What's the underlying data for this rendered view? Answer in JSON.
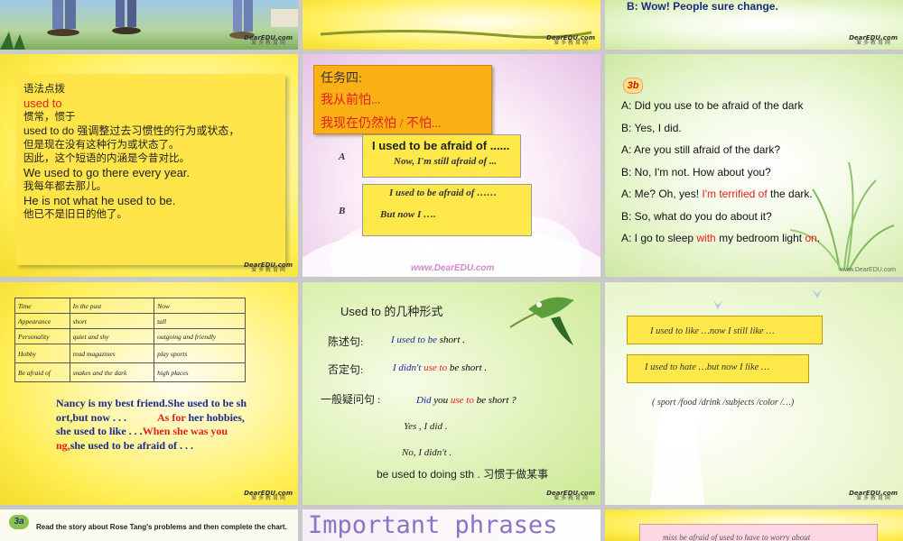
{
  "logo": {
    "brand": "DearEDU.com",
    "sub": "爱 多 教 育 网"
  },
  "s3": {
    "line": "B: Wow! People sure change."
  },
  "s4": {
    "lines": [
      "语法点拨",
      "used to",
      "惯常，惯于",
      "used to do  强调整过去习惯性的行为或状态，",
      "但是现在没有这种行为或状态了。",
      "因此，这个短语的内涵是今昔对比。",
      "We used to go there every year.",
      "我每年都去那儿。",
      "He is not what he used to be.",
      "他已不是旧日的他了。"
    ]
  },
  "s5": {
    "task_title": "任务四:",
    "task_l1": "我从前怕...",
    "task_l2": "我现在仍然怕 / 不怕...",
    "a_label": "A",
    "a_l1": "I used to be afraid of ......",
    "a_l2": "Now, I'm still afraid of ...",
    "b_label": "B",
    "b_l1": "I used to be afraid of ……",
    "b_l2": "But now I ….",
    "footer": "www.DearEDU.com"
  },
  "s6": {
    "badge": "3b",
    "lines": [
      {
        "pre": "A: Did you use to be afraid of the dark",
        "red": "",
        "post": ""
      },
      {
        "pre": "B: Yes, I did.",
        "red": "",
        "post": ""
      },
      {
        "pre": "A: Are you still afraid of the dark?",
        "red": "",
        "post": ""
      },
      {
        "pre": "B: No, I'm not. How about you?",
        "red": "",
        "post": ""
      },
      {
        "pre": "A: Me? Oh, yes! ",
        "red": "I'm terrified of",
        "post": " the dark."
      },
      {
        "pre": "B: So, what do you  do about it?",
        "red": "",
        "post": ""
      },
      {
        "pre": "A: I go to sleep ",
        "red": "with",
        "post": " my bedroom light "
      }
    ],
    "last_red": "on",
    "last_end": ".",
    "footer": "www.DearEDU.com"
  },
  "s7": {
    "table": [
      [
        "Time",
        "In the past",
        "Now"
      ],
      [
        "Appearance",
        "short",
        "tall"
      ],
      [
        "Personality",
        "quiet and shy",
        "outgoing and friendly"
      ],
      [
        "Hobby",
        "read magazines",
        "play sports"
      ],
      [
        "Be afraid of",
        "snakes and the dark",
        "high places"
      ]
    ],
    "p1": "Nancy is my best friend.She used to be sh",
    "p2": "ort,but now  .  .  .",
    "p2r": "As for",
    "p2b": " her hobbies,",
    "p3": "she used to like  .  .  .",
    "p3r": "When she was you",
    "p4r": "ng,",
    "p4": "she used to be afraid of  .  .  ."
  },
  "s8": {
    "title_a": "Used to ",
    "title_b": "的几种形式",
    "r1l": "陈述句:",
    "r1a": "I used to ",
    "r1b": "be ",
    "r1c": "short .",
    "r2l": "否定句:",
    "r2a": "I ",
    "r2b": "didn't",
    "r2c": "  use to ",
    "r2d": "be short .",
    "r3l": "一般疑问句 :",
    "r3a": "Did ",
    "r3b": "you ",
    "r3c": "use to ",
    "r3d": "be short  ?",
    "r4": "Yes , I did .",
    "r5": "No, I didn't .",
    "r6": "be used to doing sth . 习惯于做某事"
  },
  "s9": {
    "box1": "I used to like …now  I  still  like …",
    "box2": "I used to hate  …but now I like …",
    "hint": "( sport /food /drink /subjects /color /…)"
  },
  "s10": {
    "badge": "3a",
    "text": "Read the story about Rose Tang's problems and then complete the chart."
  },
  "s11": {
    "title": "Important  phrases"
  },
  "s12": {
    "text": "miss    be afraid of    used to    have to    worry about"
  }
}
